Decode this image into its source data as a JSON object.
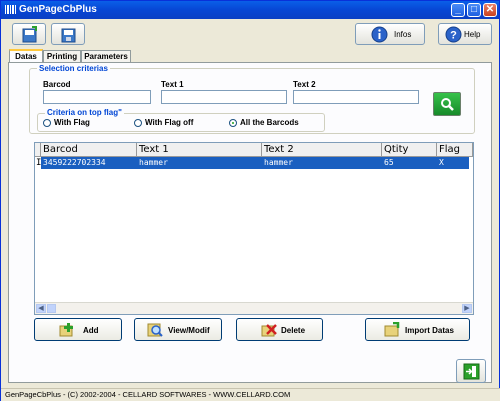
{
  "window": {
    "title": "GenPageCbPlus",
    "minimize": "_",
    "maximize": "□",
    "close": "✕"
  },
  "toolbar": {
    "infos_label": "Infos",
    "help_label": "Help"
  },
  "tabs": [
    {
      "label": "Datas"
    },
    {
      "label": "Printing"
    },
    {
      "label": "Parameters"
    }
  ],
  "selection": {
    "title": "Selection criterias",
    "barcode_label": "Barcod",
    "text1_label": "Text 1",
    "text2_label": "Text 2",
    "barcode_value": "",
    "text1_value": "",
    "text2_value": "",
    "flag_group_title": "Criteria on top flag\"",
    "radios": [
      {
        "label": "With Flag",
        "checked": false
      },
      {
        "label": "With Flag off",
        "checked": false
      },
      {
        "label": "All the Barcods",
        "checked": true
      }
    ]
  },
  "grid": {
    "columns": [
      "Barcod",
      "Text 1",
      "Text 2",
      "Qtity",
      "Flag"
    ],
    "rows": [
      {
        "marker": "I",
        "barcod": "3459222702334",
        "text1": "hammer",
        "text2": "hammer",
        "qtity": "65",
        "flag": "X"
      }
    ]
  },
  "actions": {
    "add": "Add",
    "view": "View/Modif",
    "delete": "Delete",
    "import": "Import Datas"
  },
  "status_bar": {
    "text": "GenPageCbPlus - (C) 2002-2004 - CELLARD SOFTWARES - WWW.CELLARD.COM"
  },
  "colors": {
    "selection_row": "#1a5fc0",
    "group_title": "#0046d5"
  }
}
